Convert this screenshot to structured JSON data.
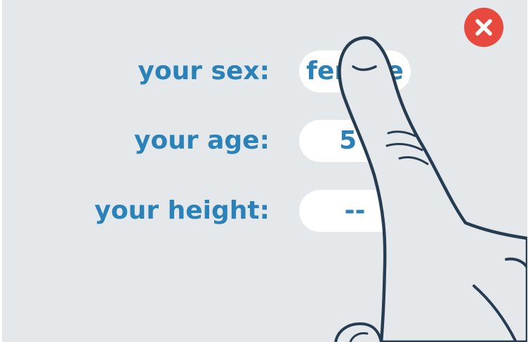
{
  "close_button": {
    "icon": "close-icon",
    "color": "#e8493f"
  },
  "form": {
    "accent_color": "#2a82b9",
    "rows": [
      {
        "label": "your sex:",
        "value": "female"
      },
      {
        "label": "your age:",
        "value": "5"
      },
      {
        "label": "your height:",
        "value": "--"
      }
    ]
  },
  "overlay": {
    "icon": "pointing-hand-icon"
  }
}
